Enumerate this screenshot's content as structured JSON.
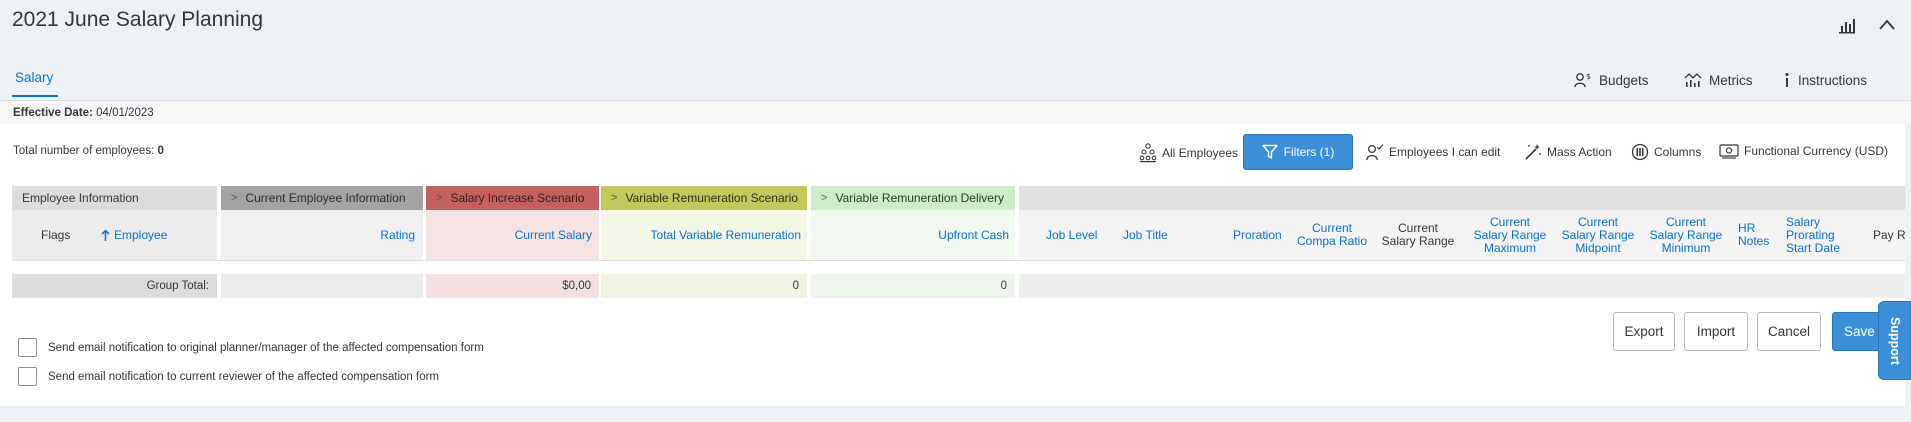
{
  "header": {
    "title": "2021 June Salary Planning"
  },
  "tabs": [
    {
      "label": "Salary",
      "active": true
    }
  ],
  "top_links": {
    "budgets": "Budgets",
    "metrics": "Metrics",
    "instructions": "Instructions"
  },
  "effective": {
    "label": "Effective Date:",
    "value": "04/01/2023"
  },
  "summary": {
    "total_label": "Total number of employees:",
    "total_value": "0"
  },
  "toolbar": {
    "all_employees": "All Employees",
    "filters": "Filters (1)",
    "employees_edit": "Employees I can edit",
    "mass_action": "Mass Action",
    "columns": "Columns",
    "functional_currency": "Functional Currency (USD)"
  },
  "table": {
    "groups": {
      "employee_information": "Employee Information",
      "current_employee_information": "Current Employee Information",
      "salary_increase_scenario": "Salary Increase Scenario",
      "variable_remuneration_scenario": "Variable Remuneration Scenario",
      "variable_remuneration_delivery": "Variable Remuneration Delivery"
    },
    "columns": {
      "flags": "Flags",
      "employee": "Employee",
      "rating": "Rating",
      "current_salary": "Current Salary",
      "total_variable_remuneration": "Total Variable Remuneration",
      "upfront_cash": "Upfront Cash",
      "job_level": "Job Level",
      "job_title": "Job Title",
      "proration": "Proration",
      "current_compa_ratio": "Current Compa Ratio",
      "current_salary_range": "Current Salary Range",
      "current_salary_range_maximum": "Current Salary Range Maximum",
      "current_salary_range_midpoint": "Current Salary Range Midpoint",
      "current_salary_range_minimum": "Current Salary Range Minimum",
      "hr_notes": "HR Notes",
      "salary_prorating_start_date": "Salary Prorating Start Date",
      "pay_truncated": "Pay R"
    },
    "group_total": {
      "label": "Group Total:",
      "current_salary": "$0,00",
      "total_variable_remuneration": "0",
      "upfront_cash": "0"
    }
  },
  "actions": {
    "export": "Export",
    "import": "Import",
    "cancel": "Cancel",
    "save": "Save"
  },
  "support": {
    "label": "Support"
  },
  "notifications": {
    "planner": "Send email notification to original planner/manager of the affected compensation form",
    "reviewer": "Send email notification to current reviewer of the affected compensation form"
  },
  "colors": {
    "accent": "#0a6ed1",
    "primary_button": "#3b8fd9",
    "group_current_employee": "#a3a3a3",
    "group_salary_increase": "#c56060",
    "group_variable_scenario": "#c5c75c",
    "group_variable_delivery": "#ccedc7"
  }
}
